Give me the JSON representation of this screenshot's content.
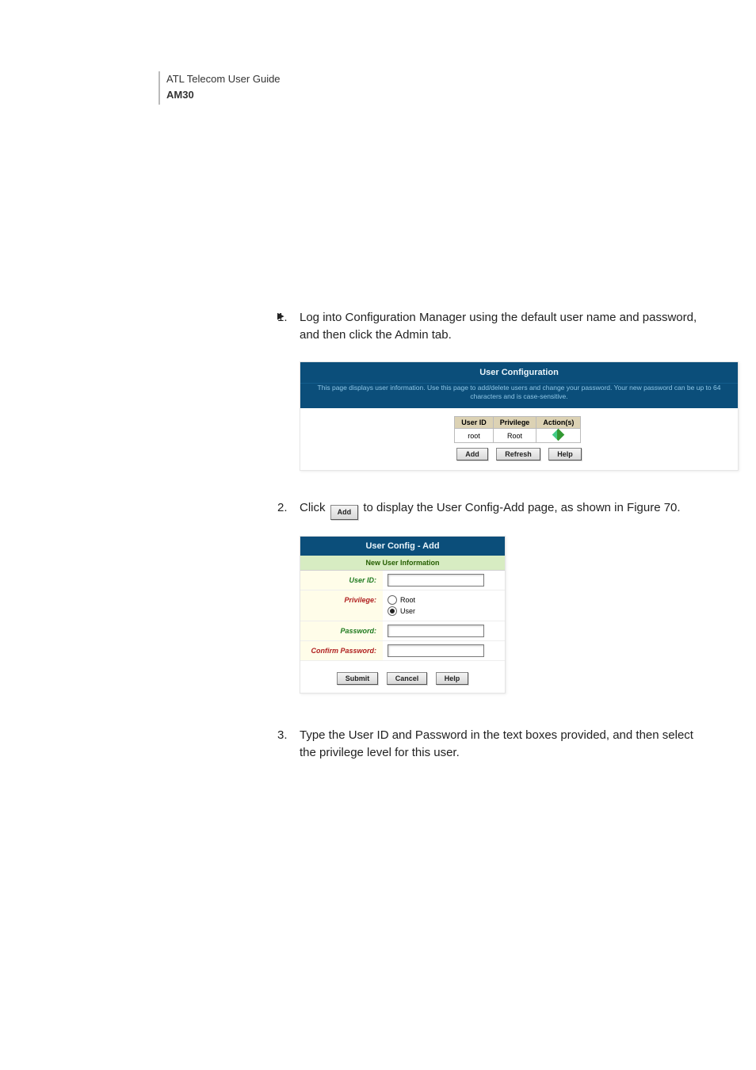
{
  "header": {
    "line1": "ATL Telecom User Guide",
    "line2": "AM30"
  },
  "bullets": {
    "b1": "",
    "b2": ""
  },
  "steps": {
    "s1": {
      "num": "1.",
      "text": "Log into Configuration Manager using the default user name and password, and then click the Admin tab."
    },
    "s2": {
      "num": "2.",
      "text_pre": "Click ",
      "btn": "Add",
      "text_post": " to display the User Config-Add page, as shown in Figure 70."
    },
    "s3": {
      "num": "3.",
      "text": "Type the User ID and Password in the text boxes provided, and then select the privilege level for this user."
    }
  },
  "fig1": {
    "title": "User Configuration",
    "desc": "This page displays user information. Use this page to add/delete users and change your password. Your new password can be up to 64 characters and is case-sensitive.",
    "headers": {
      "c1": "User ID",
      "c2": "Privilege",
      "c3": "Action(s)"
    },
    "row": {
      "userid": "root",
      "priv": "Root"
    },
    "buttons": {
      "add": "Add",
      "refresh": "Refresh",
      "help": "Help"
    }
  },
  "fig2": {
    "title": "User Config - Add",
    "subtitle": "New User Information",
    "fields": {
      "userid": "User ID:",
      "privilege": "Privilege:",
      "password": "Password:",
      "confirm": "Confirm Password:"
    },
    "radios": {
      "root": "Root",
      "user": "User"
    },
    "buttons": {
      "submit": "Submit",
      "cancel": "Cancel",
      "help": "Help"
    }
  }
}
